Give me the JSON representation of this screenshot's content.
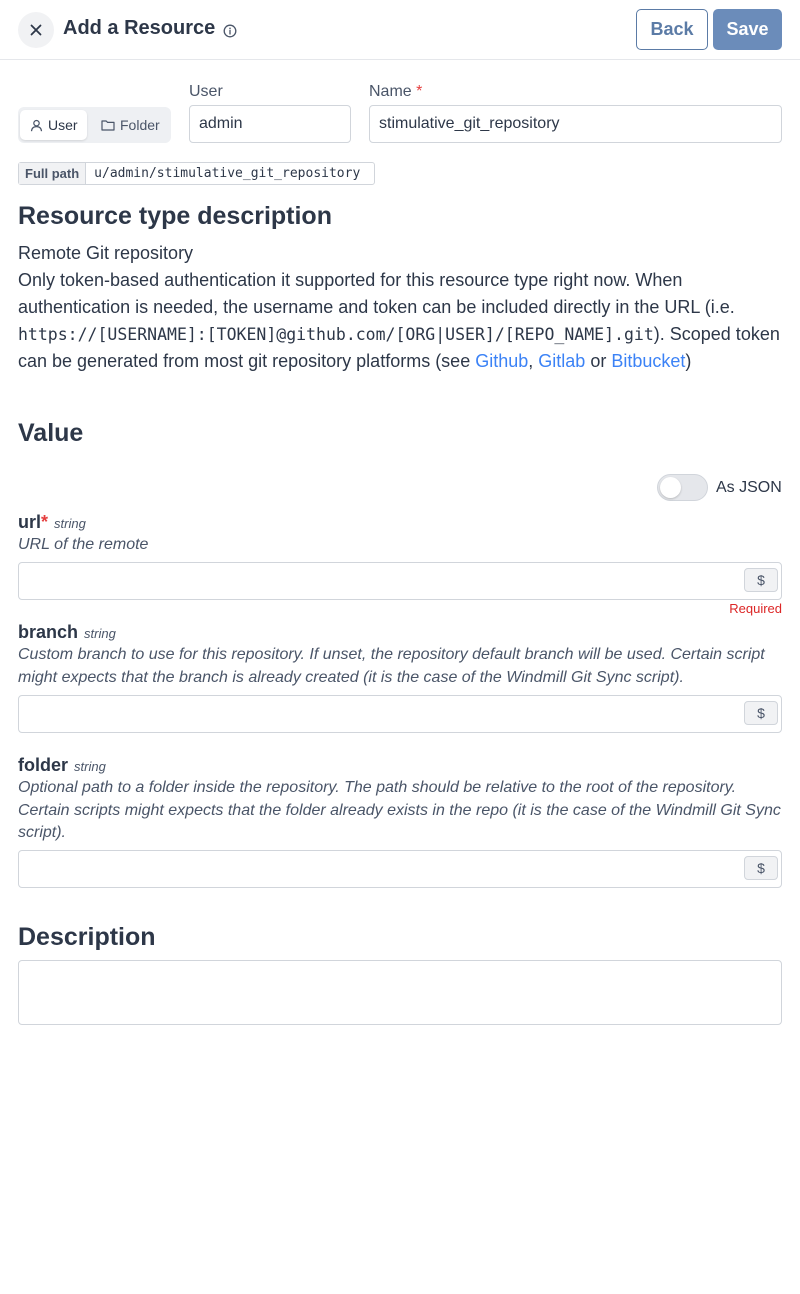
{
  "header": {
    "title": "Add a Resource",
    "back_label": "Back",
    "save_label": "Save"
  },
  "owner_toggle": {
    "user_label": "User",
    "folder_label": "Folder"
  },
  "owner_field": {
    "label": "User",
    "value": "admin"
  },
  "name_field": {
    "label": "Name",
    "required_mark": "*",
    "value": "stimulative_git_repository"
  },
  "full_path": {
    "label": "Full path",
    "value": "u/admin/stimulative_git_repository"
  },
  "resource_type": {
    "heading": "Resource type description",
    "line1": "Remote Git repository",
    "line2_a": "Only token-based authentication it supported for this resource type right now. When authentication is needed, the username and token can be included directly in the URL (i.e. ",
    "line2_code": "https://[USERNAME]:[TOKEN]@github.com/[ORG|USER]/[REPO_NAME].git",
    "line2_b": "). Scoped token can be generated from most git repository platforms (see ",
    "link_github": "Github",
    "sep1": ", ",
    "link_gitlab": "Gitlab",
    "sep2": " or ",
    "link_bitbucket": "Bitbucket",
    "end": ")"
  },
  "value_section": {
    "heading": "Value",
    "as_json_label": "As JSON",
    "as_json_enabled": false
  },
  "fields": {
    "url": {
      "name": "url",
      "required_mark": "*",
      "type": "string",
      "description": "URL of the remote",
      "dollar": "$",
      "error": "Required",
      "value": ""
    },
    "branch": {
      "name": "branch",
      "type": "string",
      "description": "Custom branch to use for this repository. If unset, the repository default branch will be used. Certain script might expects that the branch is already created (it is the case of the Windmill Git Sync script).",
      "dollar": "$",
      "value": ""
    },
    "folder": {
      "name": "folder",
      "type": "string",
      "description": "Optional path to a folder inside the repository. The path should be relative to the root of the repository. Certain scripts might expects that the folder already exists in the repo (it is the case of the Windmill Git Sync script).",
      "dollar": "$",
      "value": ""
    }
  },
  "description_section": {
    "heading": "Description",
    "value": ""
  },
  "icons": {
    "close": "close-icon",
    "info": "info-icon",
    "user": "user-icon",
    "folder": "folder-icon"
  },
  "colors": {
    "accent": "#5b7ba6",
    "save_bg": "#6b8cba",
    "link": "#3b82f6",
    "required": "#dc2626"
  }
}
